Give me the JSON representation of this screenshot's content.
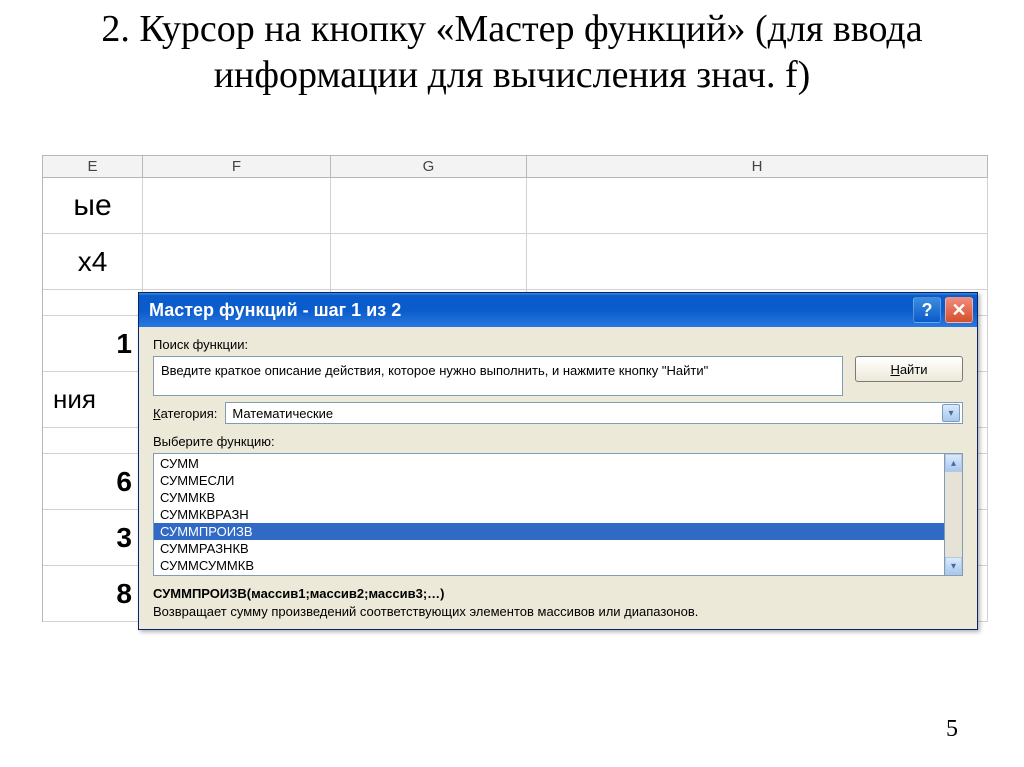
{
  "slide": {
    "title": "2. Курсор на кнопку «Мастер функций» (для ввода информации для вычисления знач. f)",
    "page_number": "5"
  },
  "sheet": {
    "cols": {
      "E": "E",
      "F": "F",
      "G": "G",
      "H": "H"
    },
    "cells": {
      "r1_partial": "ые",
      "r2_e": "x4",
      "r3_e": "1",
      "r4_partial": "ния",
      "r5_e": "6",
      "r6_e": "3",
      "r7_e": "8"
    }
  },
  "dialog": {
    "title": "Мастер функций - шаг 1 из 2",
    "search_label": "Поиск функции:",
    "search_text": "Введите краткое описание действия, которое нужно выполнить, и нажмите кнопку \"Найти\"",
    "find_btn": "Найти",
    "category_label": "Категория:",
    "category_value": "Математические",
    "choose_label": "Выберите функцию:",
    "functions": [
      "СУММ",
      "СУММЕСЛИ",
      "СУММКВ",
      "СУММКВРАЗН",
      "СУММПРОИЗВ",
      "СУММРАЗНКВ",
      "СУММСУММКВ"
    ],
    "selected_index": 4,
    "syntax": "СУММПРОИЗВ(массив1;массив2;массив3;…)",
    "description": "Возвращает сумму произведений соответствующих элементов массивов или диапазонов."
  }
}
